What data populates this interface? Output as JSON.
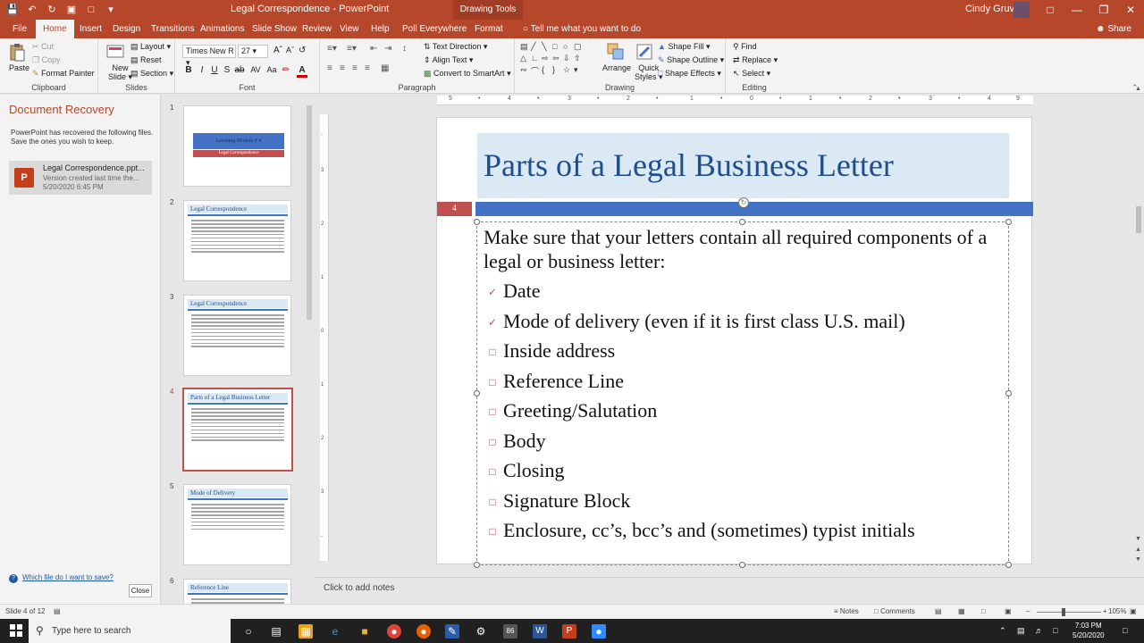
{
  "window": {
    "title": "Legal Correspondence - PowerPoint",
    "context_group": "Drawing Tools",
    "user": "Cindy Gruver"
  },
  "tabs": [
    "File",
    "Home",
    "Insert",
    "Design",
    "Transitions",
    "Animations",
    "Slide Show",
    "Review",
    "View",
    "Help",
    "Poll Everywhere",
    "Format"
  ],
  "active_tab": "Home",
  "tell_me": "Tell me what you want to do",
  "share": "Share",
  "ribbon": {
    "clipboard": {
      "label": "Clipboard",
      "paste": "Paste",
      "cut": "Cut",
      "copy": "Copy",
      "format_painter": "Format Painter"
    },
    "slides": {
      "label": "Slides",
      "new_slide": "New",
      "new_slide2": "Slide",
      "layout": "Layout",
      "reset": "Reset",
      "section": "Section"
    },
    "font": {
      "label": "Font",
      "family": "Times New R",
      "size": "27"
    },
    "paragraph": {
      "label": "Paragraph",
      "text_direction": "Text Direction",
      "align_text": "Align Text",
      "convert_smartart": "Convert to SmartArt"
    },
    "drawing": {
      "label": "Drawing",
      "arrange": "Arrange",
      "quick_styles": "Quick",
      "quick_styles2": "Styles",
      "shape_fill": "Shape Fill",
      "shape_outline": "Shape Outline",
      "shape_effects": "Shape Effects"
    },
    "editing": {
      "label": "Editing",
      "find": "Find",
      "replace": "Replace",
      "select": "Select"
    }
  },
  "recovery": {
    "title": "Document Recovery",
    "description": "PowerPoint has recovered the following files.  Save the ones you wish to keep.",
    "file_name": "Legal Correspondence.ppt...",
    "file_sub1": "Version created last time the...",
    "file_sub2": "5/20/2020 6:45 PM",
    "help_link": "Which file do I want to save?",
    "close": "Close"
  },
  "thumbnails": [
    {
      "num": "1",
      "title": "Learning Module # 4",
      "subtitle": "Legal Correspondence"
    },
    {
      "num": "2",
      "title": "Legal Correspondence"
    },
    {
      "num": "3",
      "title": "Legal Correspondence"
    },
    {
      "num": "4",
      "title": "Parts of a Legal Business Letter"
    },
    {
      "num": "5",
      "title": "Mode of Delivery"
    },
    {
      "num": "6",
      "title": "Reference Line"
    }
  ],
  "slide": {
    "number": "4",
    "title": "Parts of a Legal Business Letter",
    "intro": "Make sure that your letters contain all required components of a legal or business letter:",
    "items": [
      {
        "text": "Date",
        "checked": true
      },
      {
        "text": "Mode of delivery (even if it is first class U.S. mail)",
        "checked": true
      },
      {
        "text": "Inside address",
        "checked": false
      },
      {
        "text": "Reference Line",
        "checked": false
      },
      {
        "text": "Greeting/Salutation",
        "checked": false
      },
      {
        "text": "Body",
        "checked": false
      },
      {
        "text": "Closing",
        "checked": false
      },
      {
        "text": "Signature Block",
        "checked": false
      },
      {
        "text": "Enclosure, cc’s, bcc’s and (sometimes) typist initials",
        "checked": false
      }
    ]
  },
  "notes_placeholder": "Click to add notes",
  "status": {
    "slide_of": "Slide 4 of 12",
    "notes": "Notes",
    "comments": "Comments",
    "zoom": "105%"
  },
  "taskbar": {
    "search_placeholder": "Type here to search",
    "time": "7:03 PM",
    "date": "5/20/2020"
  },
  "colors": {
    "accent": "#b7472a",
    "title_blue": "#1f4e8c",
    "band_blue": "#4472c4",
    "red": "#c0504d"
  }
}
